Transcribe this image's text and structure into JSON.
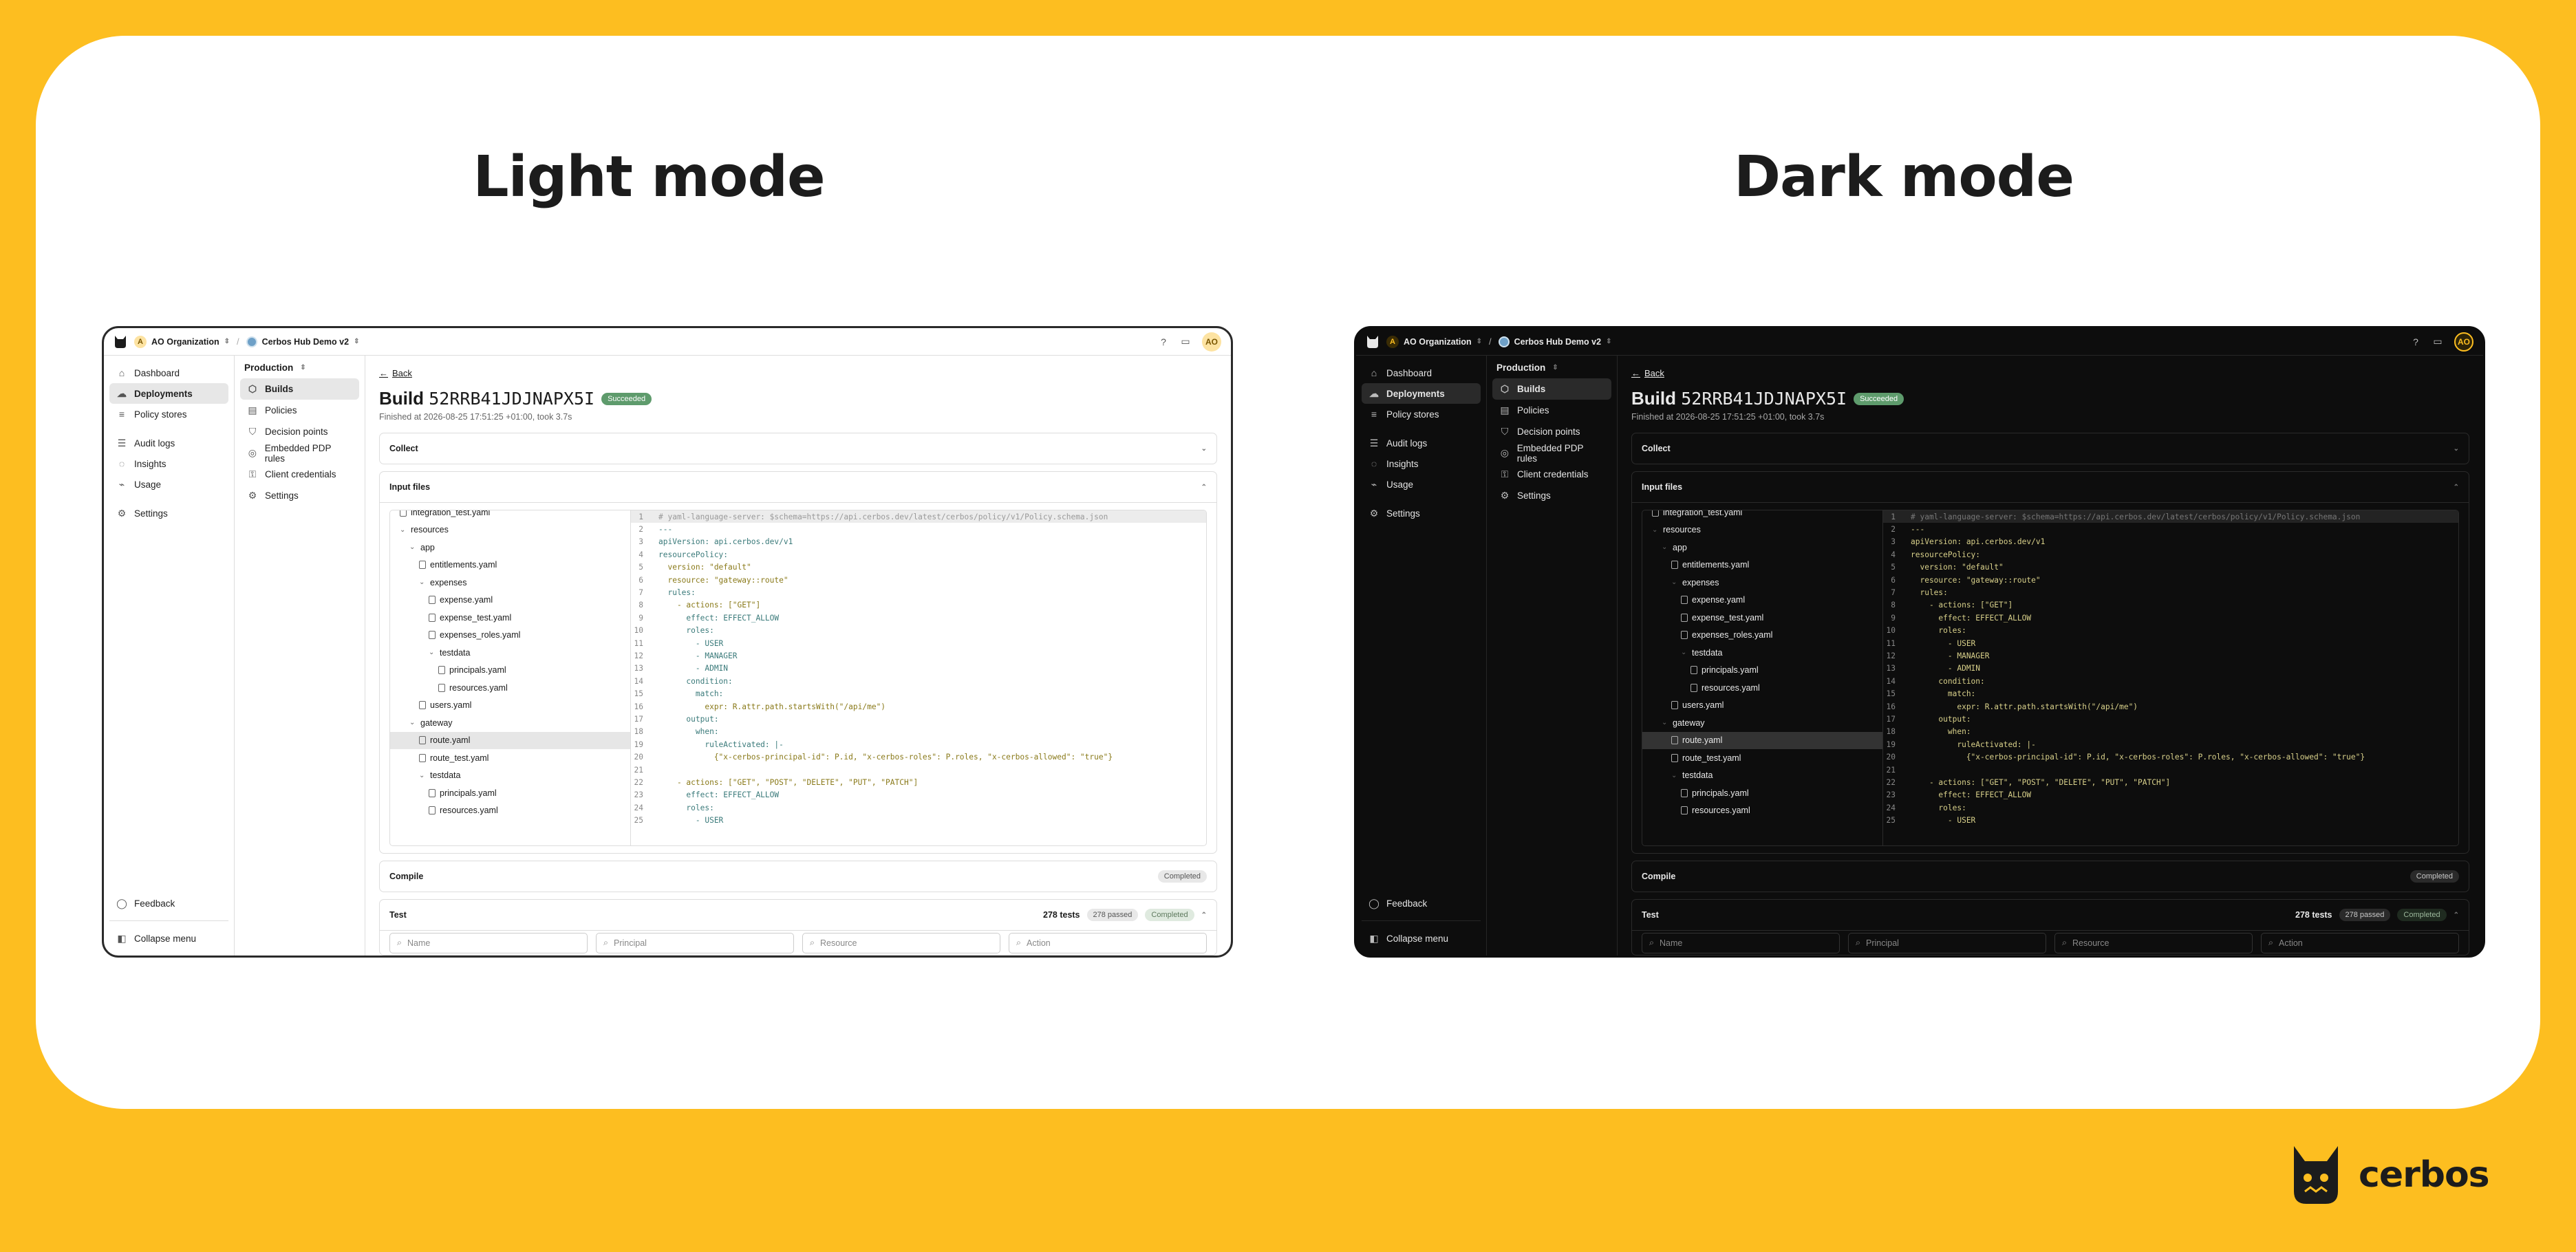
{
  "headings": {
    "light": "Light mode",
    "dark": "Dark mode"
  },
  "brand": {
    "name": "cerbos"
  },
  "app": {
    "org": {
      "initial": "A",
      "name": "AO Organization"
    },
    "project": {
      "name": "Cerbos Hub Demo v2"
    },
    "avatar": "AO",
    "sidebar": {
      "items": [
        "Dashboard",
        "Deployments",
        "Policy stores",
        "Audit logs",
        "Insights",
        "Usage",
        "Settings"
      ],
      "feedback": "Feedback",
      "collapse": "Collapse menu"
    },
    "subnav": {
      "environment": "Production",
      "items": [
        "Builds",
        "Policies",
        "Decision points",
        "Embedded PDP rules",
        "Client credentials",
        "Settings"
      ]
    },
    "main": {
      "back": "Back",
      "build_prefix": "Build",
      "build_id": "52RRB41JDJNAPX5I",
      "status": "Succeeded",
      "finished": "Finished at 2026-08-25 17:51:25 +01:00, took 3.7s",
      "collect": "Collect",
      "input_files": "Input files",
      "compile": "Compile",
      "compile_status": "Completed",
      "test": "Test",
      "test_count": "278 tests",
      "test_passed": "278 passed",
      "test_status": "Completed",
      "filters": [
        "Name",
        "Principal",
        "Resource",
        "Action"
      ]
    },
    "tree": [
      {
        "label": "integration_test.yaml",
        "depth": 1,
        "kind": "file"
      },
      {
        "label": "resources",
        "depth": 1,
        "kind": "folder"
      },
      {
        "label": "app",
        "depth": 2,
        "kind": "folder"
      },
      {
        "label": "entitlements.yaml",
        "depth": 3,
        "kind": "file"
      },
      {
        "label": "expenses",
        "depth": 3,
        "kind": "folder"
      },
      {
        "label": "expense.yaml",
        "depth": 4,
        "kind": "file"
      },
      {
        "label": "expense_test.yaml",
        "depth": 4,
        "kind": "file"
      },
      {
        "label": "expenses_roles.yaml",
        "depth": 4,
        "kind": "file"
      },
      {
        "label": "testdata",
        "depth": 4,
        "kind": "folder"
      },
      {
        "label": "principals.yaml",
        "depth": 5,
        "kind": "file"
      },
      {
        "label": "resources.yaml",
        "depth": 5,
        "kind": "file"
      },
      {
        "label": "users.yaml",
        "depth": 3,
        "kind": "file"
      },
      {
        "label": "gateway",
        "depth": 2,
        "kind": "folder"
      },
      {
        "label": "route.yaml",
        "depth": 3,
        "kind": "file",
        "selected": true
      },
      {
        "label": "route_test.yaml",
        "depth": 3,
        "kind": "file"
      },
      {
        "label": "testdata",
        "depth": 3,
        "kind": "folder"
      },
      {
        "label": "principals.yaml",
        "depth": 4,
        "kind": "file"
      },
      {
        "label": "resources.yaml",
        "depth": 4,
        "kind": "file"
      }
    ],
    "code": [
      "# yaml-language-server: $schema=https://api.cerbos.dev/latest/cerbos/policy/v1/Policy.schema.json",
      "---",
      "apiVersion: api.cerbos.dev/v1",
      "resourcePolicy:",
      "  version: \"default\"",
      "  resource: \"gateway::route\"",
      "  rules:",
      "    - actions: [\"GET\"]",
      "      effect: EFFECT_ALLOW",
      "      roles:",
      "        - USER",
      "        - MANAGER",
      "        - ADMIN",
      "      condition:",
      "        match:",
      "          expr: R.attr.path.startsWith(\"/api/me\")",
      "      output:",
      "        when:",
      "          ruleActivated: |-",
      "            {\"x-cerbos-principal-id\": P.id, \"x-cerbos-roles\": P.roles, \"x-cerbos-allowed\": \"true\"}",
      "",
      "    - actions: [\"GET\", \"POST\", \"DELETE\", \"PUT\", \"PATCH\"]",
      "      effect: EFFECT_ALLOW",
      "      roles:",
      "        - USER"
    ],
    "colors": {
      "accent": "#FDBE20",
      "success": "#5e9b6c"
    }
  }
}
